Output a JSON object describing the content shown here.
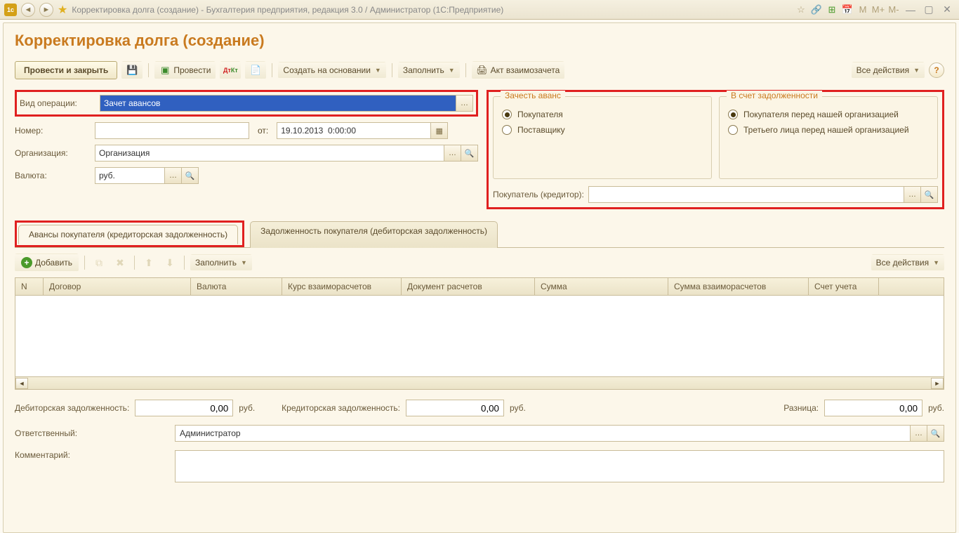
{
  "titlebar": {
    "logo_text": "1c",
    "title": "Корректировка долга (создание) - Бухгалтерия предприятия, редакция 3.0 / Администратор  (1С:Предприятие)",
    "m_labels": [
      "M",
      "M+",
      "M-"
    ]
  },
  "page_title": "Корректировка долга (создание)",
  "toolbar": {
    "post_and_close": "Провести и закрыть",
    "post": "Провести",
    "create_based_on": "Создать на основании",
    "fill": "Заполнить",
    "netting_act": "Акт взаимозачета",
    "all_actions": "Все действия"
  },
  "form": {
    "operation_type_label": "Вид операции:",
    "operation_type_value": "Зачет авансов",
    "number_label": "Номер:",
    "number_value": "",
    "date_label": "от:",
    "date_value": "19.10.2013  0:00:00",
    "org_label": "Организация:",
    "org_value": "Организация",
    "currency_label": "Валюта:",
    "currency_value": "руб."
  },
  "group_advance": {
    "legend": "Зачесть аванс",
    "opt_buyer": "Покупателя",
    "opt_supplier": "Поставщику"
  },
  "group_debt": {
    "legend": "В счет задолженности",
    "opt_buyer_to_us": "Покупателя перед нашей организацией",
    "opt_third_to_us": "Третьего лица перед нашей организацией"
  },
  "buyer_creditor": {
    "label": "Покупатель (кредитор):",
    "value": ""
  },
  "tabs": {
    "tab1": "Авансы покупателя (кредиторская задолженность)",
    "tab2": "Задолженность покупателя (дебиторская задолженность)"
  },
  "table_toolbar": {
    "add": "Добавить",
    "fill": "Заполнить",
    "all_actions": "Все действия"
  },
  "table": {
    "columns": [
      "N",
      "Договор",
      "Валюта",
      "Курс взаиморасчетов",
      "Документ расчетов",
      "Сумма",
      "Сумма взаиморасчетов",
      "Счет учета"
    ],
    "widths": [
      40,
      210,
      130,
      170,
      190,
      190,
      200,
      100
    ]
  },
  "totals": {
    "debit_label": "Дебиторская задолженность:",
    "debit_value": "0,00",
    "credit_label": "Кредиторская задолженность:",
    "credit_value": "0,00",
    "diff_label": "Разница:",
    "diff_value": "0,00",
    "currency": "руб."
  },
  "bottom": {
    "responsible_label": "Ответственный:",
    "responsible_value": "Администратор",
    "comment_label": "Комментарий:",
    "comment_value": ""
  }
}
